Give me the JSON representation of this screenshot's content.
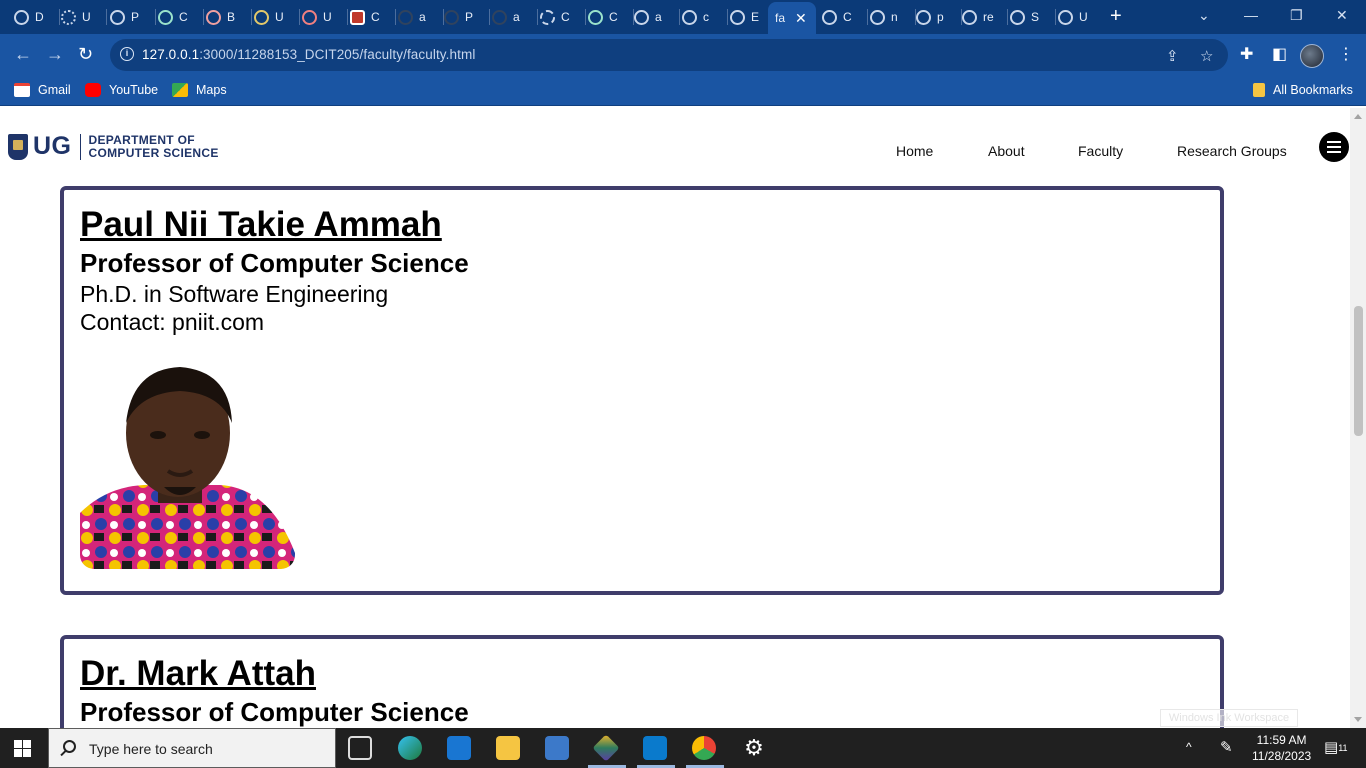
{
  "browser": {
    "tabs": [
      {
        "label": "D",
        "icon": "chrome-icon"
      },
      {
        "label": "U",
        "icon": "dotted-circle-icon"
      },
      {
        "label": "P",
        "icon": "loading-circle-icon"
      },
      {
        "label": "C",
        "icon": "chatgpt-icon"
      },
      {
        "label": "B",
        "icon": "site-icon"
      },
      {
        "label": "U",
        "icon": "site-icon"
      },
      {
        "label": "U",
        "icon": "site-icon"
      },
      {
        "label": "C",
        "icon": "site-icon"
      },
      {
        "label": "a",
        "icon": "github-icon"
      },
      {
        "label": "P",
        "icon": "github-icon"
      },
      {
        "label": "a",
        "icon": "github-icon"
      },
      {
        "label": "C",
        "icon": "gear-icon"
      },
      {
        "label": "C",
        "icon": "chatgpt-icon"
      },
      {
        "label": "a",
        "icon": "globe-icon"
      },
      {
        "label": "c",
        "icon": "globe-icon"
      },
      {
        "label": "E",
        "icon": "globe-icon"
      },
      {
        "label": "fa",
        "icon": "globe-icon",
        "active": true
      },
      {
        "label": "C",
        "icon": "globe-icon"
      },
      {
        "label": "n",
        "icon": "globe-icon"
      },
      {
        "label": "p",
        "icon": "globe-icon"
      },
      {
        "label": "re",
        "icon": "globe-icon"
      },
      {
        "label": "S",
        "icon": "globe-icon"
      },
      {
        "label": "U",
        "icon": "globe-icon"
      }
    ],
    "url_host": "127.0.0.1",
    "url_rest": ":3000/11288153_DCIT205/faculty/faculty.html",
    "bookmarks": [
      {
        "label": "Gmail",
        "color": "#ea4335"
      },
      {
        "label": "YouTube",
        "color": "#ff0000"
      },
      {
        "label": "Maps",
        "color": "#34a853"
      }
    ],
    "all_bookmarks": "All Bookmarks"
  },
  "site": {
    "logo_short": "UG",
    "logo_line1": "DEPARTMENT OF",
    "logo_line2": "COMPUTER SCIENCE",
    "nav": [
      "Home",
      "About",
      "Faculty",
      "Research Groups"
    ]
  },
  "faculty": [
    {
      "name": "Paul Nii Takie Ammah",
      "role": "Professor of Computer Science",
      "degree": "Ph.D. in Software Engineering",
      "contact": "Contact: pniit.com"
    },
    {
      "name": "Dr. Mark Attah",
      "role": "Professor of Computer Science"
    }
  ],
  "taskbar": {
    "search_placeholder": "Type here to search",
    "time": "11:59 AM",
    "date": "11/28/2023",
    "notification_count": "11"
  },
  "colors": {
    "card_border": "#3f3d6b",
    "brand_navy": "#1f3468",
    "browser_blue": "#1a55a3"
  }
}
